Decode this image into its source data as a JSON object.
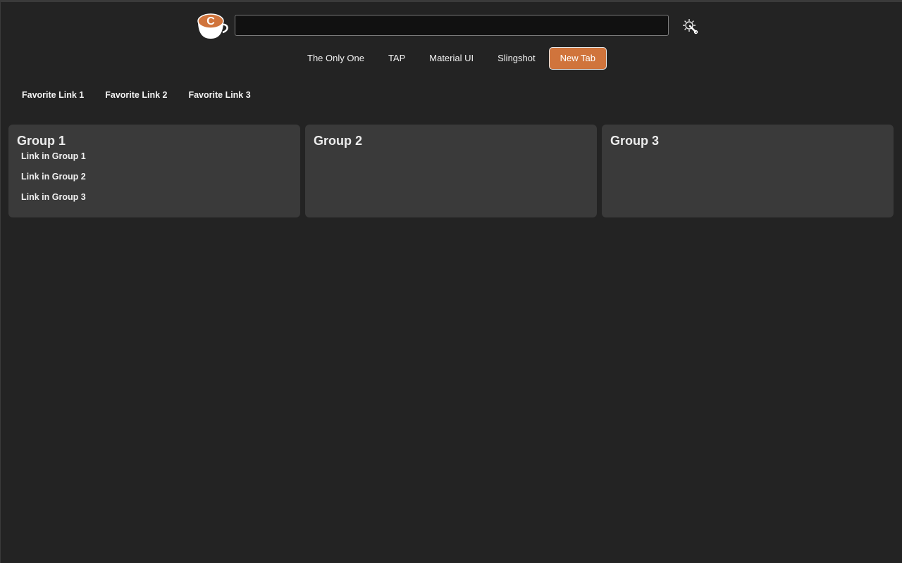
{
  "header": {
    "logo_icon": "coffee-cup-logo-icon",
    "logo_letter": "C",
    "search": {
      "value": "",
      "placeholder": ""
    },
    "settings_icon": "gear-wrench-icon"
  },
  "tabs": [
    {
      "label": "The Only One",
      "active": false
    },
    {
      "label": "TAP",
      "active": false
    },
    {
      "label": "Material UI",
      "active": false
    },
    {
      "label": "Slingshot",
      "active": false
    },
    {
      "label": "New Tab",
      "active": true
    }
  ],
  "favorites": [
    {
      "label": "Favorite Link 1"
    },
    {
      "label": "Favorite Link 2"
    },
    {
      "label": "Favorite Link 3"
    }
  ],
  "groups": [
    {
      "title": "Group 1",
      "links": [
        "Link in Group 1",
        "Link in Group 2",
        "Link in Group 3"
      ]
    },
    {
      "title": "Group 2",
      "links": []
    },
    {
      "title": "Group 3",
      "links": []
    }
  ],
  "colors": {
    "background": "#232323",
    "panel": "#3a3a3a",
    "accent": "#d0743c",
    "search_bg": "#111111"
  }
}
